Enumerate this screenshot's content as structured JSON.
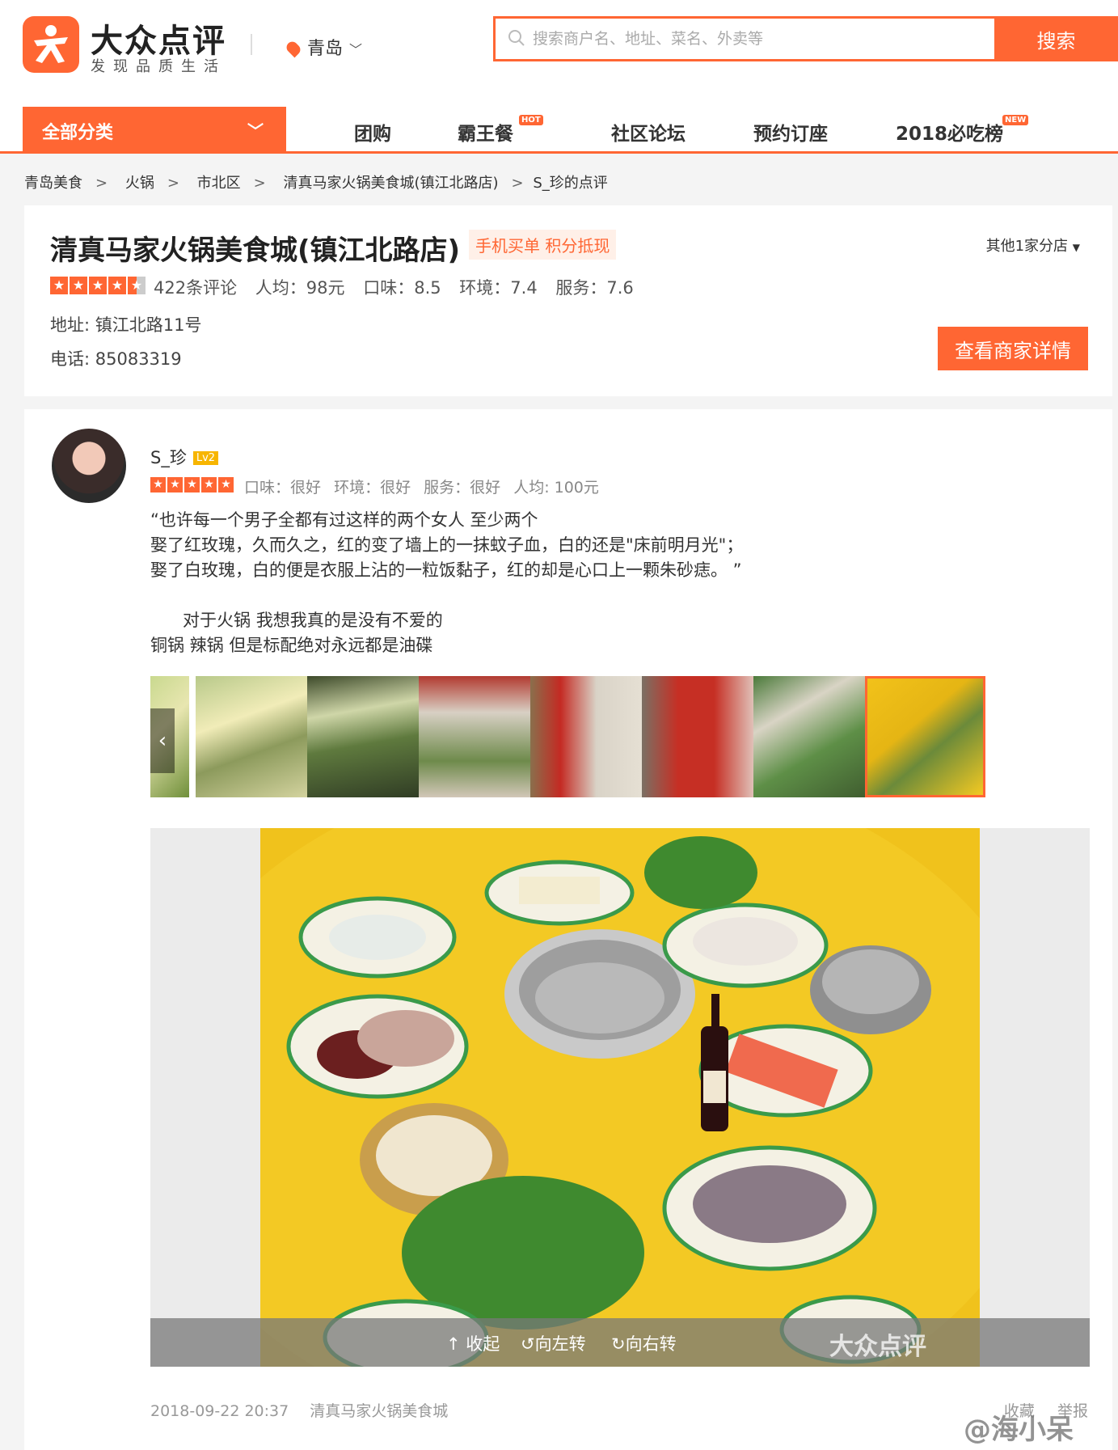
{
  "header": {
    "logo_title": "大众点评",
    "logo_subtitle": "发现品质生活",
    "city": "青岛",
    "search_placeholder": "搜索商户名、地址、菜名、外卖等",
    "search_button": "搜索"
  },
  "nav": {
    "category_label": "全部分类",
    "items": [
      {
        "label": "团购",
        "badge": ""
      },
      {
        "label": "霸王餐",
        "badge": "HOT"
      },
      {
        "label": "社区论坛",
        "badge": ""
      },
      {
        "label": "预约订座",
        "badge": ""
      },
      {
        "label": "2018必吃榜",
        "badge": "NEW"
      }
    ]
  },
  "breadcrumb": [
    "青岛美食",
    "火锅",
    "市北区",
    "清真马家火锅美食城(镇江北路店)",
    "S_珍的点评"
  ],
  "breadcrumb_separator": ">",
  "shop": {
    "name": "清真马家火锅美食城(镇江北路店)",
    "promo": "手机买单 积分抵现",
    "branches": "其他1家分店",
    "rating_stars": 4.5,
    "review_count": "422条评论",
    "avg_price": "人均：98元",
    "taste": "口味：8.5",
    "environment": "环境：7.4",
    "service": "服务：7.6",
    "address": "地址: 镇江北路11号",
    "phone": "电话: 85083319",
    "detail_button": "查看商家详情"
  },
  "review": {
    "username": "S_珍",
    "level": "Lv2",
    "rating_stars": 5,
    "taste": "口味：很好",
    "environment": "环境：很好",
    "service": "服务：很好",
    "avg_price": "人均: 100元",
    "text_lines": [
      "“也许每一个男子全都有过这样的两个女人 至少两个",
      "娶了红玫瑰，久而久之，红的变了墙上的一抹蚊子血，白的还是\"床前明月光\"；",
      "娶了白玫瑰，白的便是衣服上沾的一粒饭黏子，红的却是心口上一颗朱砂痣。 ”",
      "",
      "      对于火锅 我想我真的是没有不爱的",
      "铜锅 辣锅 但是标配绝对永远都是油碟"
    ],
    "photo_actions": {
      "collapse": "收起",
      "rotate_left": "向左转",
      "rotate_right": "向右转"
    },
    "photo_watermark": "大众点评",
    "date": "2018-09-22 20:37",
    "shop_short": "清真马家火锅美食城",
    "actions": [
      "收藏",
      "举报"
    ]
  },
  "overlay_watermark": "@海小呆",
  "colors": {
    "accent": "#ff6633",
    "level_badge": "#f7b500"
  }
}
